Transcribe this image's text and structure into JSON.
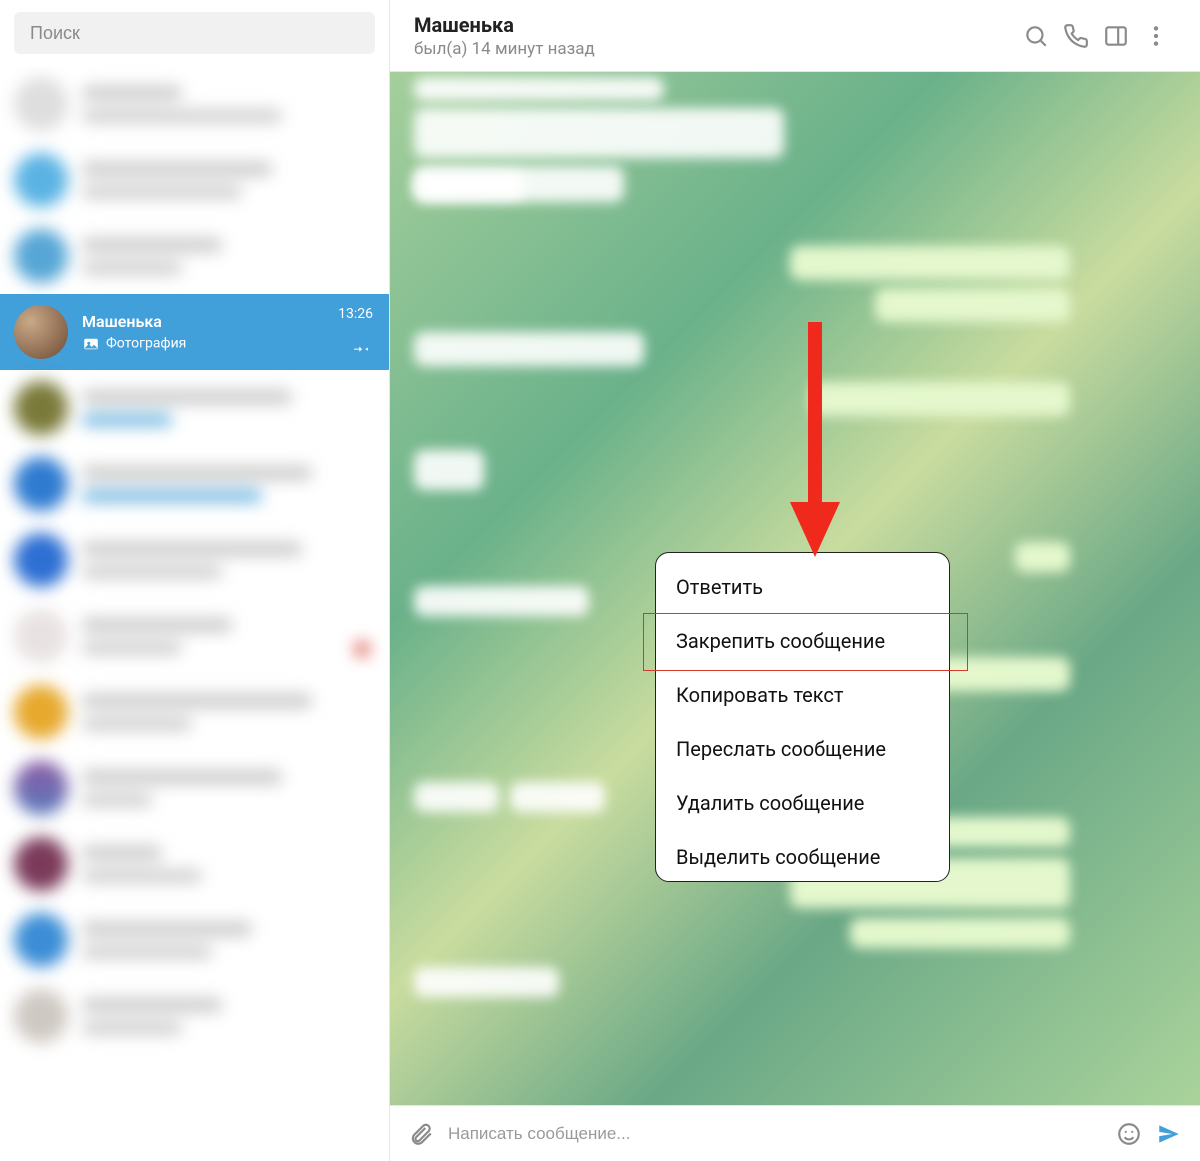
{
  "search": {
    "placeholder": "Поиск"
  },
  "active_chat": {
    "name": "Машенька",
    "preview_icon": "photo",
    "preview": "Фотография",
    "time": "13:26"
  },
  "header": {
    "title": "Машенька",
    "status": "был(а) 14 минут назад"
  },
  "context_menu": {
    "items": [
      "Ответить",
      "Закрепить сообщение",
      "Копировать текст",
      "Переслать сообщение",
      "Удалить сообщение",
      "Выделить сообщение"
    ],
    "highlighted_index": 1
  },
  "compose": {
    "placeholder": "Написать сообщение..."
  }
}
